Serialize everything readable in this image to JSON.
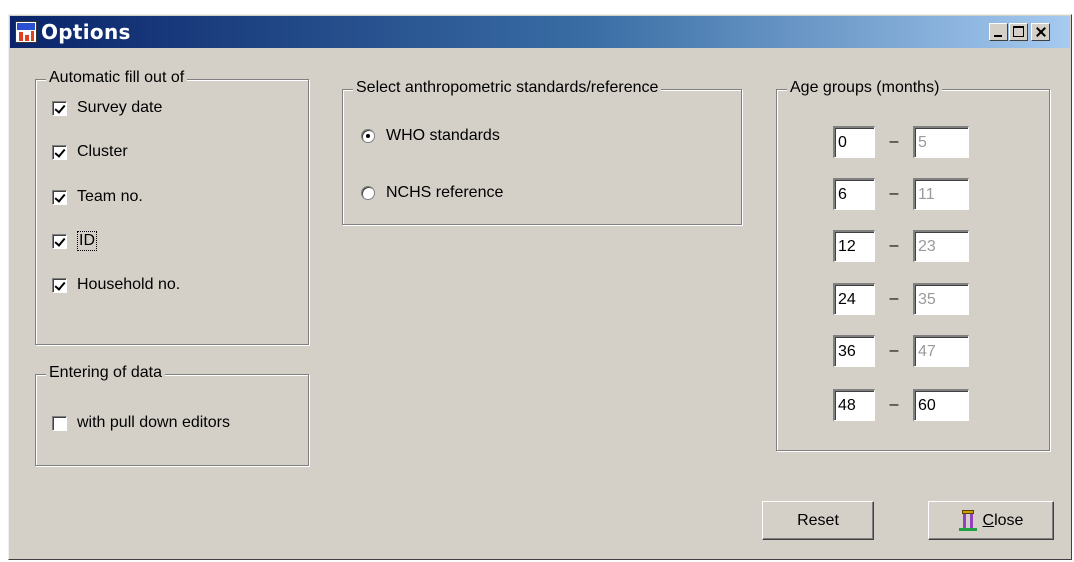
{
  "window": {
    "title": "Options"
  },
  "autofill": {
    "legend": "Automatic fill out of",
    "items": [
      {
        "label": "Survey date",
        "checked": true
      },
      {
        "label": "Cluster",
        "checked": true
      },
      {
        "label": "Team no.",
        "checked": true
      },
      {
        "label": "ID",
        "checked": true,
        "focused": true
      },
      {
        "label": "Household no.",
        "checked": true
      }
    ]
  },
  "entering": {
    "legend": "Entering of data",
    "items": [
      {
        "label": "with pull down editors",
        "checked": false
      }
    ]
  },
  "standards": {
    "legend": "Select anthropometric standards/reference",
    "options": [
      {
        "label": "WHO standards",
        "selected": true
      },
      {
        "label": "NCHS reference",
        "selected": false
      }
    ]
  },
  "age_groups": {
    "legend": "Age groups (months)",
    "separator": "–",
    "rows": [
      {
        "from": "0",
        "to": "5"
      },
      {
        "from": "6",
        "to": "11"
      },
      {
        "from": "12",
        "to": "23"
      },
      {
        "from": "24",
        "to": "35"
      },
      {
        "from": "36",
        "to": "47"
      },
      {
        "from": "48",
        "to": "60"
      }
    ]
  },
  "buttons": {
    "reset_label": "Reset",
    "close_mnemonic": "C",
    "close_rest": "lose"
  },
  "colors": {
    "dialog_bg": "#d4d0c8",
    "titlebar_start": "#0a246a",
    "titlebar_end": "#a6caf0",
    "disabled_text": "#9a9a9a"
  },
  "icons": [
    "who-app-icon",
    "minimize-icon",
    "maximize-icon",
    "close-x-icon",
    "exit-door-icon"
  ]
}
